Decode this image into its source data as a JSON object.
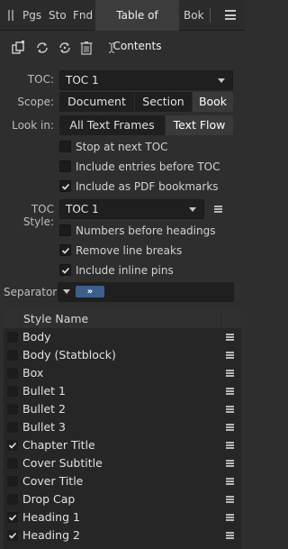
{
  "tabs": [
    {
      "label": "Pgs"
    },
    {
      "label": "Sto"
    },
    {
      "label": "Fnd"
    },
    {
      "label": "Table of Contents",
      "active": true
    },
    {
      "label": "Bok"
    }
  ],
  "toc": {
    "label": "TOC:",
    "value": "TOC 1"
  },
  "scope": {
    "label": "Scope:",
    "options": [
      "Document",
      "Section",
      "Book"
    ],
    "selected": "Book"
  },
  "look_in": {
    "label": "Look in:",
    "options": [
      "All Text Frames",
      "Text Flow"
    ],
    "selected": "Text Flow"
  },
  "options1": [
    {
      "label": "Stop at next TOC",
      "checked": false
    },
    {
      "label": "Include entries before TOC",
      "checked": false
    },
    {
      "label": "Include as PDF bookmarks",
      "checked": true
    }
  ],
  "toc_style": {
    "label": "TOC Style:",
    "value": "TOC 1"
  },
  "options2": [
    {
      "label": "Numbers before headings",
      "checked": false
    },
    {
      "label": "Remove line breaks",
      "checked": true
    },
    {
      "label": "Include inline pins",
      "checked": true
    }
  ],
  "separator": {
    "label": "Separator:",
    "token": "»"
  },
  "style_table": {
    "header": "Style Name",
    "rows": [
      {
        "name": "Body",
        "checked": false
      },
      {
        "name": "Body (Statblock)",
        "checked": false
      },
      {
        "name": "Box",
        "checked": false
      },
      {
        "name": "Bullet 1",
        "checked": false
      },
      {
        "name": "Bullet 2",
        "checked": false
      },
      {
        "name": "Bullet 3",
        "checked": false
      },
      {
        "name": "Chapter Title",
        "checked": true
      },
      {
        "name": "Cover Subtitle",
        "checked": false
      },
      {
        "name": "Cover Title",
        "checked": false
      },
      {
        "name": "Drop Cap",
        "checked": false
      },
      {
        "name": "Heading 1",
        "checked": true
      },
      {
        "name": "Heading 2",
        "checked": true
      }
    ]
  },
  "colors": {
    "background": "#2e2e2e",
    "accent": "#3d5f8e"
  }
}
